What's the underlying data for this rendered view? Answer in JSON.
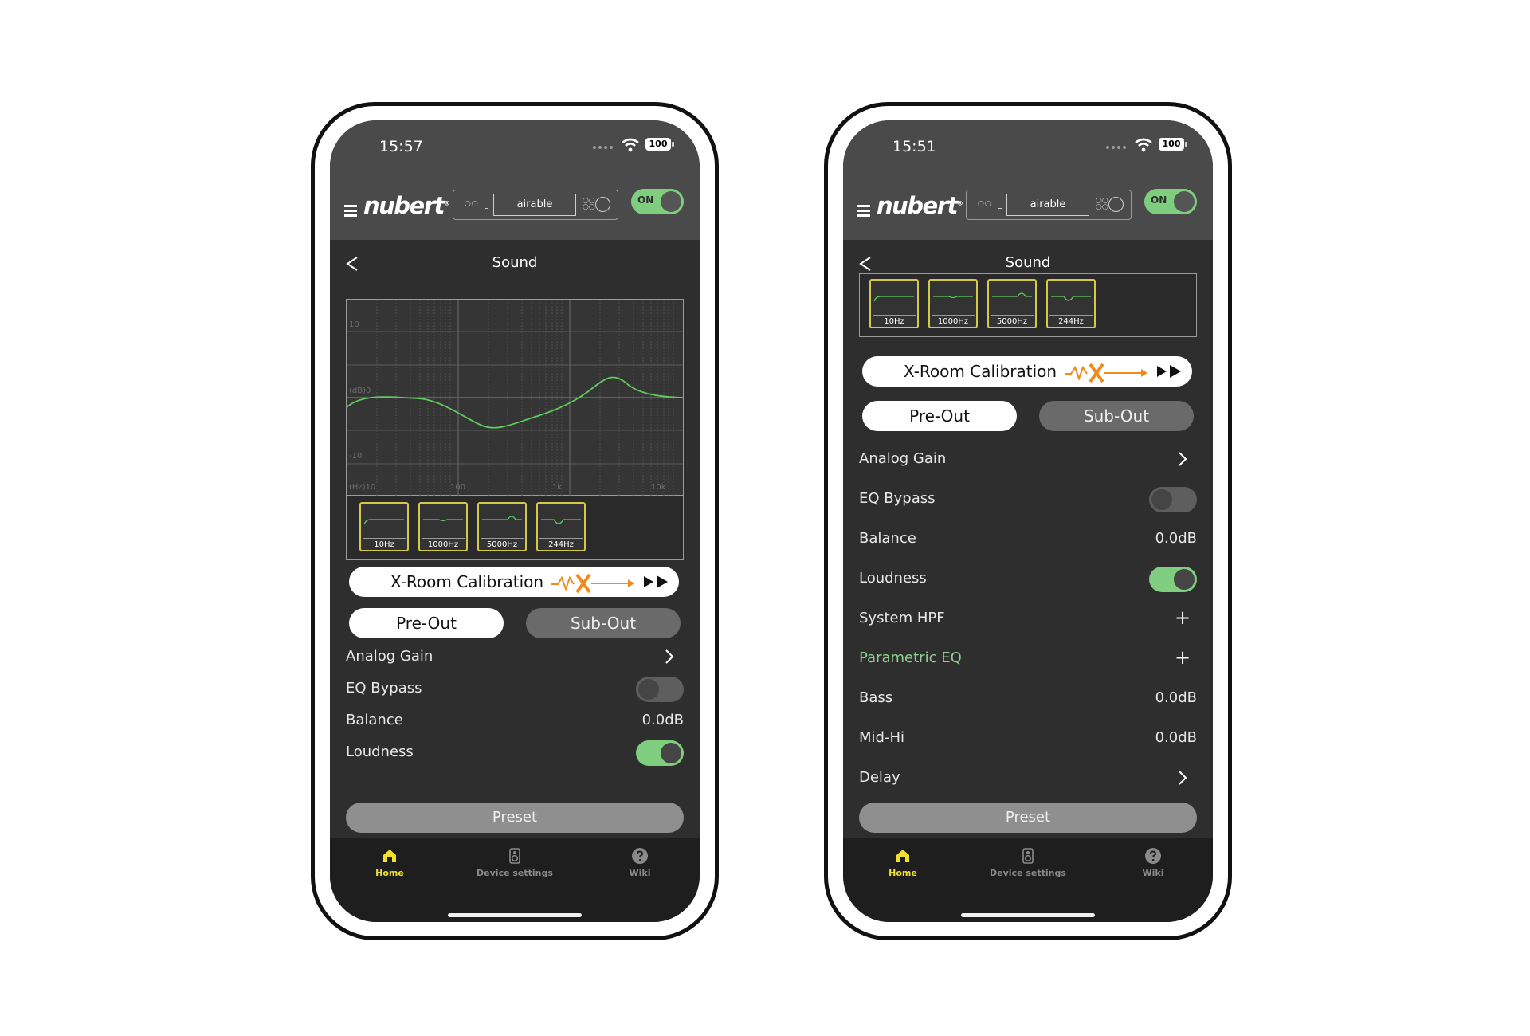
{
  "colors": {
    "accent_green": "#7fcd7f",
    "filter_border": "#d4c84a",
    "home_yellow": "#f0e030",
    "xroom_orange": "#f08a1a"
  },
  "phones": [
    {
      "status": {
        "time": "15:57",
        "battery": "100"
      },
      "header": {
        "logo": "nubert",
        "logo_mark": "®",
        "device_display": "airable",
        "power": "ON"
      },
      "page_title": "Sound",
      "eq_graph": {
        "y_labels": [
          "10",
          "(dB)0",
          "-10"
        ],
        "x_labels": [
          "(Hz)10",
          "100",
          "1k",
          "10k"
        ]
      },
      "filters": [
        {
          "label": "10Hz",
          "icon": "flat-curve-icon"
        },
        {
          "label": "1000Hz",
          "icon": "slight-dip-curve-icon"
        },
        {
          "label": "5000Hz",
          "icon": "peak-curve-icon"
        },
        {
          "label": "244Hz",
          "icon": "notch-curve-icon"
        }
      ],
      "xroom_label": "X-Room Calibration",
      "tabs": {
        "pre_out": "Pre-Out",
        "sub_out": "Sub-Out"
      },
      "settings": [
        {
          "label": "Analog Gain",
          "control": "chevron"
        },
        {
          "label": "EQ Bypass",
          "control": "switch-off"
        },
        {
          "label": "Balance",
          "value": "0.0dB"
        },
        {
          "label": "Loudness",
          "control": "switch-on"
        }
      ],
      "preset": "Preset",
      "tabbar": [
        {
          "label": "Home"
        },
        {
          "label": "Device settings"
        },
        {
          "label": "Wiki"
        }
      ]
    },
    {
      "status": {
        "time": "15:51",
        "battery": "100"
      },
      "header": {
        "logo": "nubert",
        "logo_mark": "®",
        "device_display": "airable",
        "power": "ON"
      },
      "page_title": "Sound",
      "filters": [
        {
          "label": "10Hz",
          "icon": "flat-curve-icon"
        },
        {
          "label": "1000Hz",
          "icon": "slight-dip-curve-icon"
        },
        {
          "label": "5000Hz",
          "icon": "peak-curve-icon"
        },
        {
          "label": "244Hz",
          "icon": "notch-curve-icon"
        }
      ],
      "xroom_label": "X-Room Calibration",
      "tabs": {
        "pre_out": "Pre-Out",
        "sub_out": "Sub-Out"
      },
      "settings": [
        {
          "label": "Analog Gain",
          "control": "chevron"
        },
        {
          "label": "EQ Bypass",
          "control": "switch-off"
        },
        {
          "label": "Balance",
          "value": "0.0dB"
        },
        {
          "label": "Loudness",
          "control": "switch-on"
        },
        {
          "label": "System HPF",
          "control": "plus"
        },
        {
          "label": "Parametric EQ",
          "control": "plus",
          "accent": true
        },
        {
          "label": "Bass",
          "value": "0.0dB"
        },
        {
          "label": "Mid-Hi",
          "value": "0.0dB"
        },
        {
          "label": "Delay",
          "control": "chevron"
        }
      ],
      "preset": "Preset",
      "tabbar": [
        {
          "label": "Home"
        },
        {
          "label": "Device settings"
        },
        {
          "label": "Wiki"
        }
      ]
    }
  ]
}
